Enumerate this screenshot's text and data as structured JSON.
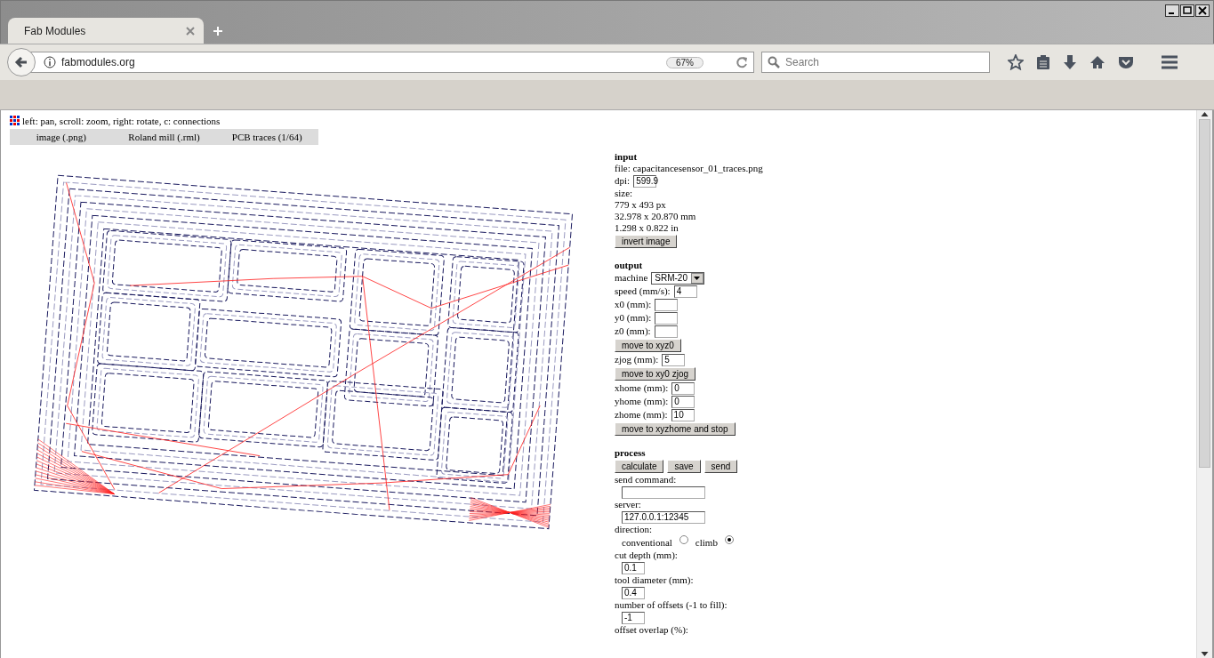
{
  "browser": {
    "tabs": [
      {
        "label": "Fab Modules",
        "selected": true
      }
    ],
    "url": "fabmodules.org",
    "zoom": "67%",
    "search": {
      "placeholder": "Search"
    }
  },
  "page": {
    "hint": "left: pan, scroll: zoom, right: rotate, c: connections",
    "menu": [
      "image (.png)",
      "Roland mill (.rml)",
      "PCB traces (1/64)"
    ],
    "panel": {
      "sections": [
        {
          "title": "input",
          "items": [
            {
              "kind": "text",
              "text": "file: capacitancesensor_01_traces.png"
            },
            {
              "kind": "field",
              "label": "dpi:",
              "value": "599.9"
            },
            {
              "kind": "text",
              "text": "size:"
            },
            {
              "kind": "text",
              "text": "779 x 493 px"
            },
            {
              "kind": "text",
              "text": "32.978 x 20.870 mm"
            },
            {
              "kind": "text",
              "text": "1.298 x 0.822 in"
            },
            {
              "kind": "button",
              "label": "invert image"
            }
          ]
        },
        {
          "title": "output",
          "items": [
            {
              "kind": "select",
              "label": "machine",
              "value": "SRM-20"
            },
            {
              "kind": "field",
              "label": "speed (mm/s):",
              "value": "4"
            },
            {
              "kind": "field",
              "label": "x0 (mm):"
            },
            {
              "kind": "field",
              "label": "y0 (mm):"
            },
            {
              "kind": "field",
              "label": "z0 (mm):"
            },
            {
              "kind": "button",
              "label": "move to xyz0"
            },
            {
              "kind": "field",
              "label": "zjog (mm):",
              "value": "5"
            },
            {
              "kind": "button",
              "label": "move to xy0 zjog"
            },
            {
              "kind": "field",
              "label": "xhome (mm):",
              "value": "0"
            },
            {
              "kind": "field",
              "label": "yhome (mm):",
              "value": "0"
            },
            {
              "kind": "field",
              "label": "zhome (mm):",
              "value": "10"
            },
            {
              "kind": "button",
              "label": "move to xyzhome and stop"
            }
          ]
        },
        {
          "title": "process",
          "items": [
            {
              "kind": "buttons",
              "labels": [
                "calculate",
                "save",
                "send"
              ]
            },
            {
              "kind": "stacked",
              "label": "send command:",
              "wide": true
            },
            {
              "kind": "stacked",
              "label": "server:",
              "value": "127.0.0.1:12345",
              "wide": true
            },
            {
              "kind": "text",
              "text": "direction:"
            },
            {
              "kind": "radio",
              "options": [
                {
                  "label": "conventional",
                  "selected": false
                },
                {
                  "label": "climb",
                  "selected": true
                }
              ]
            },
            {
              "kind": "stacked",
              "label": "cut depth (mm):",
              "value": "0.1"
            },
            {
              "kind": "stacked",
              "label": "tool diameter (mm):",
              "value": "0.4"
            },
            {
              "kind": "stacked",
              "label": "number of offsets (-1 to fill):",
              "value": "-1"
            },
            {
              "kind": "text",
              "text": "offset overlap (%):"
            }
          ]
        }
      ]
    }
  }
}
